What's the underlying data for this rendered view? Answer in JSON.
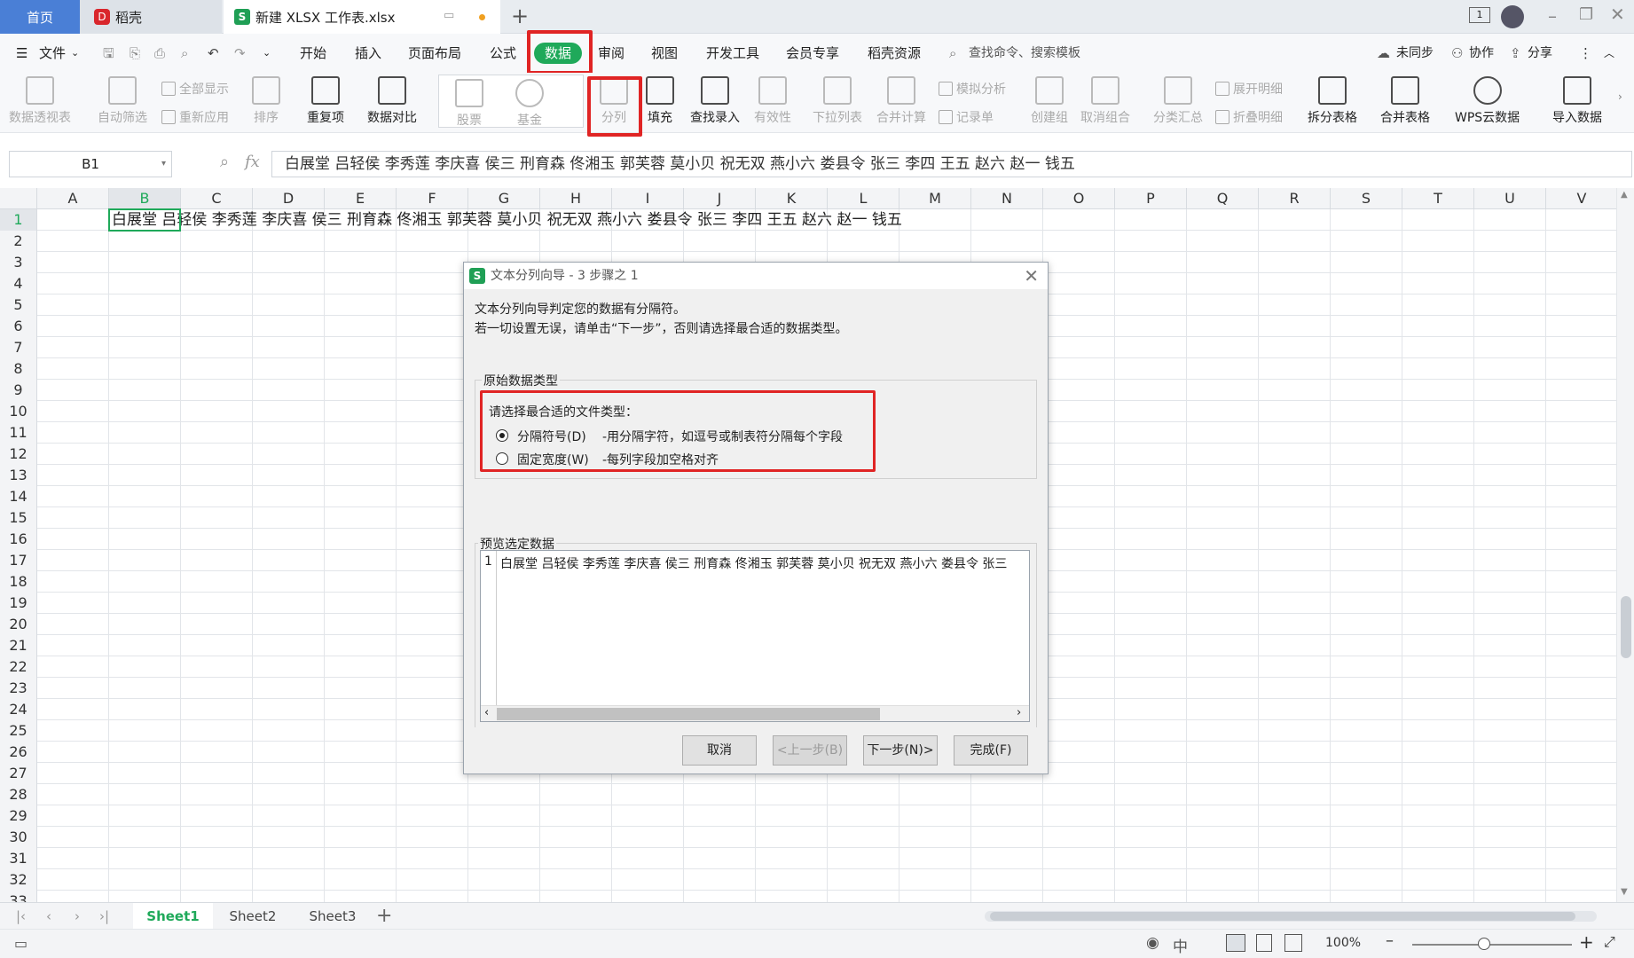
{
  "tabs": {
    "home": "首页",
    "daoke": "稻壳",
    "file": "新建 XLSX 工作表.xlsx"
  },
  "menu": {
    "file": "文件",
    "items": [
      "开始",
      "插入",
      "页面布局",
      "公式",
      "数据",
      "审阅",
      "视图",
      "开发工具",
      "会员专享",
      "稻壳资源"
    ],
    "search": "查找命令、搜索模板",
    "sync": "未同步",
    "collab": "协作",
    "share": "分享"
  },
  "ribbon": {
    "pivot": "数据透视表",
    "autofilter": "自动筛选",
    "showall": "全部显示",
    "reapply": "重新应用",
    "sort": "排序",
    "dup": "重复项",
    "compare": "数据对比",
    "stock": "股票",
    "fund": "基金",
    "split": "分列",
    "fill": "填充",
    "lookup": "查找录入",
    "valid": "有效性",
    "dropdown": "下拉列表",
    "consolidate": "合并计算",
    "simulate": "模拟分析",
    "record": "记录单",
    "group": "创建组",
    "ungroup": "取消组合",
    "subtotal": "分类汇总",
    "expand": "展开明细",
    "collapse": "折叠明细",
    "splittable": "拆分表格",
    "mergetable": "合并表格",
    "wpscloud": "WPS云数据",
    "import": "导入数据"
  },
  "namebox": "B1",
  "formula": "白展堂 吕轻侯 李秀莲 李庆喜 侯三 刑育森 佟湘玉 郭芙蓉 莫小贝 祝无双 燕小六 娄县令 张三 李四 王五 赵六 赵一 钱五",
  "columns": [
    "A",
    "B",
    "C",
    "D",
    "E",
    "F",
    "G",
    "H",
    "I",
    "J",
    "K",
    "L",
    "M",
    "N",
    "O",
    "P",
    "Q",
    "R",
    "S",
    "T",
    "U",
    "V"
  ],
  "rows": [
    "1",
    "2",
    "3",
    "4",
    "5",
    "6",
    "7",
    "8",
    "9",
    "10",
    "11",
    "12",
    "13",
    "14",
    "15",
    "16",
    "17",
    "18",
    "19",
    "20",
    "21",
    "22",
    "23",
    "24",
    "25",
    "26",
    "27",
    "28",
    "29",
    "30",
    "31",
    "32",
    "33"
  ],
  "cell_b1": "白展堂 吕轻侯 李秀莲 李庆喜 侯三 刑育森 佟湘玉 郭芙蓉 莫小贝 祝无双 燕小六 娄县令 张三 李四 王五 赵六 赵一 钱五",
  "dialog": {
    "title": "文本分列向导 - 3 步骤之 1",
    "intro1": "文本分列向导判定您的数据有分隔符。",
    "intro2": "若一切设置无误，请单击“下一步”，否则请选择最合适的数据类型。",
    "group_label": "原始数据类型",
    "choose": "请选择最合适的文件类型：",
    "opt1": "分隔符号(D)",
    "opt1_desc": "-用分隔字符，如逗号或制表符分隔每个字段",
    "opt2": "固定宽度(W)",
    "opt2_desc": "-每列字段加空格对齐",
    "preview_label": "预览选定数据",
    "preview_row": "1",
    "preview_text": "白展堂 吕轻侯 李秀莲 李庆喜 侯三 刑育森 佟湘玉 郭芙蓉 莫小贝 祝无双 燕小六 娄县令 张三",
    "cancel": "取消",
    "back": "<上一步(B)",
    "next": "下一步(N)>",
    "finish": "完成(F)"
  },
  "sheets": [
    "Sheet1",
    "Sheet2",
    "Sheet3"
  ],
  "zoom": "100%",
  "accent": "#1fa95a"
}
